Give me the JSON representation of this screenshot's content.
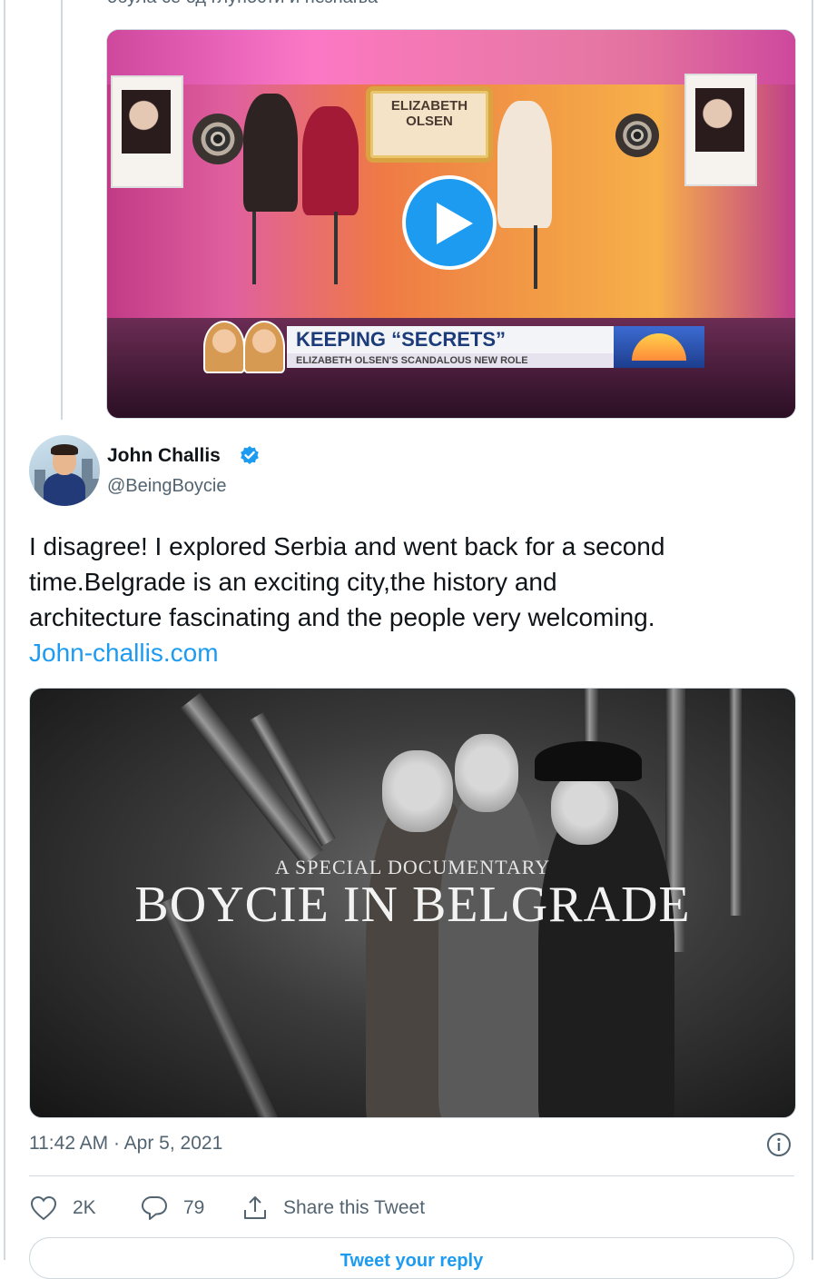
{
  "previous_tweet": {
    "cutoff_text": "обула се од глупости и незнања",
    "video": {
      "marquee_line1": "ELIZABETH",
      "marquee_line2": "OLSEN",
      "lower_third_main": "KEEPING “SECRETS”",
      "lower_third_sub": "ELIZABETH OLSEN'S SCANDALOUS NEW ROLE",
      "play_icon": "play-icon"
    }
  },
  "tweet": {
    "author_name": "John Challis",
    "verified_icon": "verified-badge-icon",
    "handle": "@BeingBoycie",
    "text_lines": [
      "I disagree! I explored Serbia and went back for a second",
      "time.Belgrade is an exciting city,the history and",
      "architecture fascinating and the people very welcoming."
    ],
    "link": "John-challis.com",
    "media": {
      "subtitle": "A SPECIAL DOCUMENTARY",
      "title": "BOYCIE IN BELGRADE"
    },
    "timestamp": "11:42 AM · Apr 5, 2021",
    "info_icon": "info-icon",
    "actions": {
      "like_count": "2K",
      "reply_count": "79",
      "share_label": "Share this Tweet"
    },
    "reply_button": "Tweet your reply"
  },
  "colors": {
    "accent": "#1d9bf0",
    "text_primary": "#0f1419",
    "text_secondary": "#536471",
    "border": "#cfd9de"
  }
}
